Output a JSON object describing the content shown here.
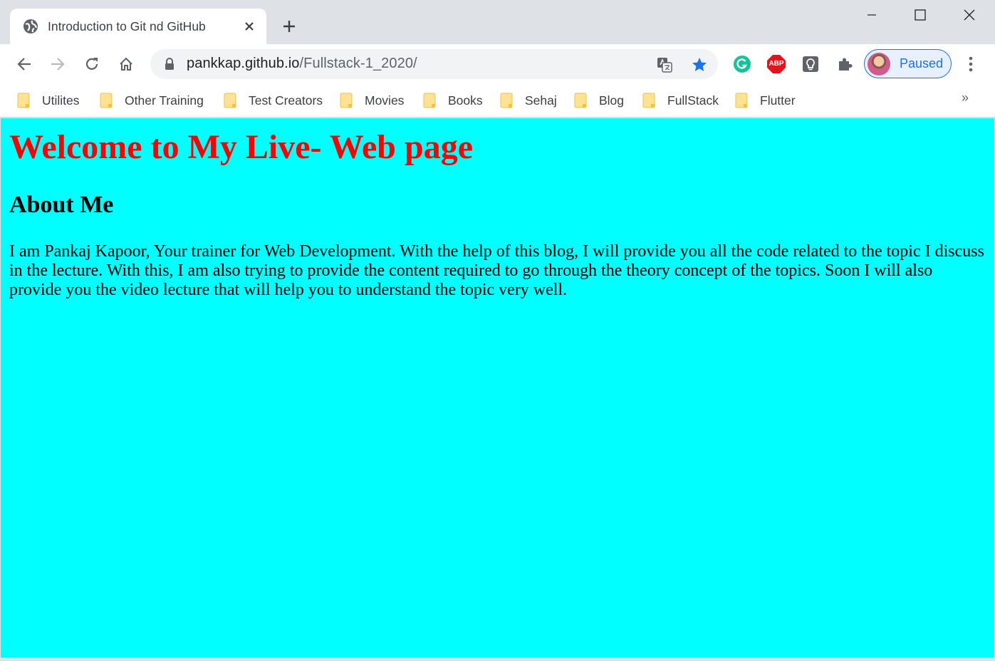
{
  "browser": {
    "tab": {
      "title": "Introduction to Git nd GitHub"
    },
    "address": {
      "host": "pankkap.github.io",
      "path": "/Fullstack-1_2020/"
    },
    "profile": {
      "label": "Paused"
    },
    "extensions": {
      "abp_label": "ABP"
    },
    "bookmarks": [
      {
        "label": "Utilites"
      },
      {
        "label": "Other Training"
      },
      {
        "label": "Test Creators"
      },
      {
        "label": "Movies"
      },
      {
        "label": "Books"
      },
      {
        "label": "Sehaj"
      },
      {
        "label": "Blog"
      },
      {
        "label": "FullStack"
      },
      {
        "label": "Flutter"
      }
    ],
    "bookmarks_overflow": "»",
    "accent_color": "#1a73e8"
  },
  "page": {
    "background": "#00ffff",
    "heading": "Welcome to My Live- Web page",
    "heading_color": "#ff0000",
    "subheading": "About Me",
    "paragraph": "I am Pankaj Kapoor, Your trainer for Web Development. With the help of this blog, I will provide you all the code related to the topic I discuss in the lecture. With this, I am also trying to provide the content required to go through the theory concept of the topics. Soon I will also provide you the video lecture that will help you to understand the topic very well."
  }
}
